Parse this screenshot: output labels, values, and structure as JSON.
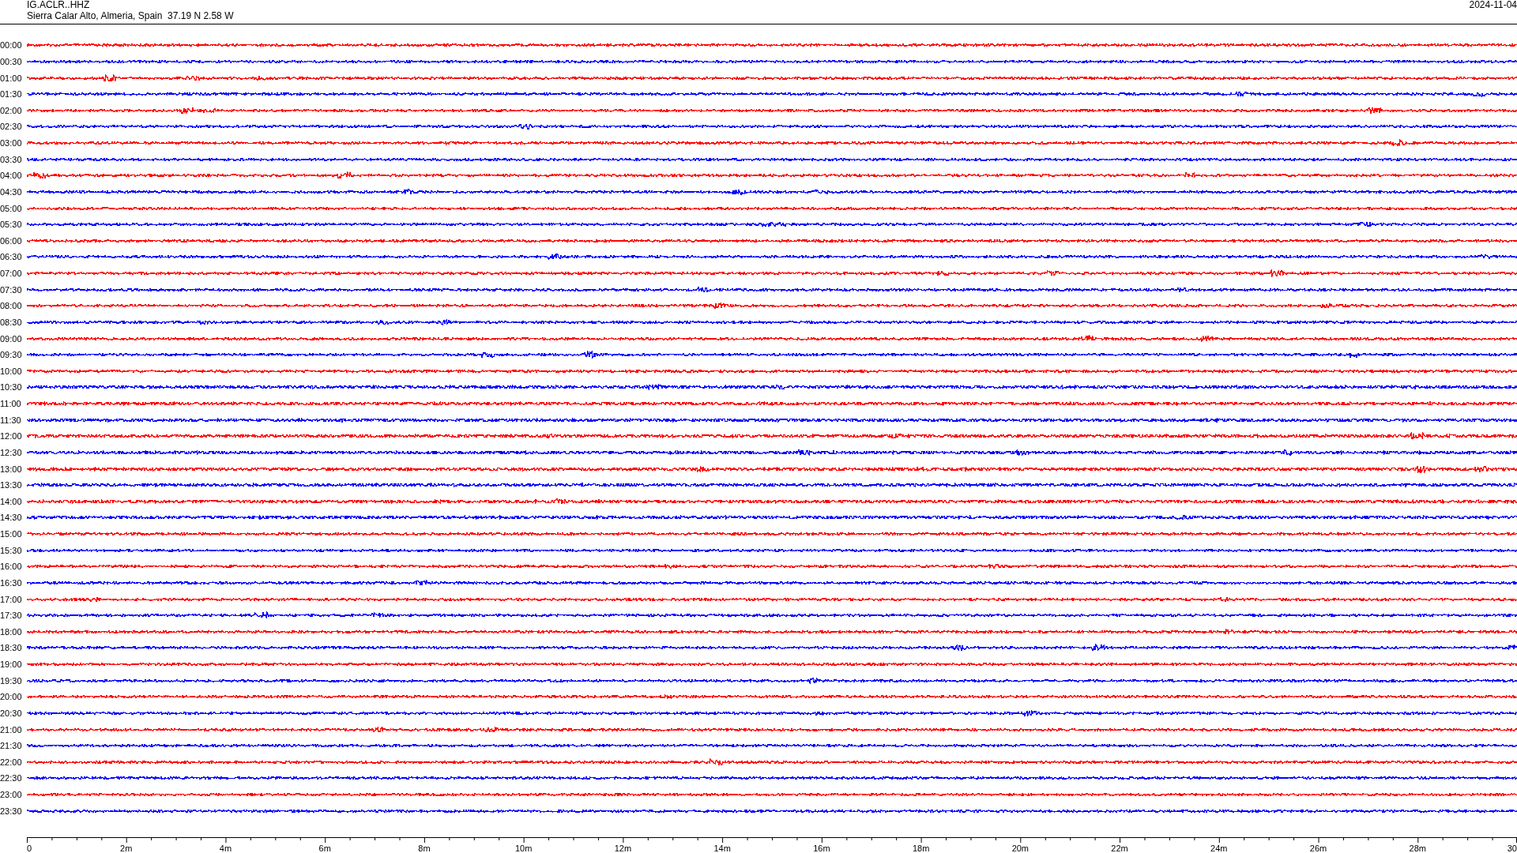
{
  "header": {
    "station": "IG.ACLR..HHZ",
    "location": "Sierra Calar Alto, Almeria, Spain  37.19 N 2.58 W",
    "date": "2024-11-04"
  },
  "traces": [
    {
      "time": "00:00",
      "color": "#ff0000"
    },
    {
      "time": "00:30",
      "color": "#0000ff"
    },
    {
      "time": "01:00",
      "color": "#ff0000"
    },
    {
      "time": "01:30",
      "color": "#0000ff"
    },
    {
      "time": "02:00",
      "color": "#ff0000"
    },
    {
      "time": "02:30",
      "color": "#0000ff"
    },
    {
      "time": "03:00",
      "color": "#ff0000"
    },
    {
      "time": "03:30",
      "color": "#0000ff"
    },
    {
      "time": "04:00",
      "color": "#ff0000"
    },
    {
      "time": "04:30",
      "color": "#0000ff"
    },
    {
      "time": "05:00",
      "color": "#ff0000"
    },
    {
      "time": "05:30",
      "color": "#0000ff"
    },
    {
      "time": "06:00",
      "color": "#ff0000"
    },
    {
      "time": "06:30",
      "color": "#0000ff"
    },
    {
      "time": "07:00",
      "color": "#ff0000"
    },
    {
      "time": "07:30",
      "color": "#0000ff"
    },
    {
      "time": "08:00",
      "color": "#ff0000"
    },
    {
      "time": "08:30",
      "color": "#0000ff"
    },
    {
      "time": "09:00",
      "color": "#ff0000"
    },
    {
      "time": "09:30",
      "color": "#0000ff"
    },
    {
      "time": "10:00",
      "color": "#ff0000"
    },
    {
      "time": "10:30",
      "color": "#0000ff"
    },
    {
      "time": "11:00",
      "color": "#ff0000"
    },
    {
      "time": "11:30",
      "color": "#0000ff"
    },
    {
      "time": "12:00",
      "color": "#ff0000"
    },
    {
      "time": "12:30",
      "color": "#0000ff"
    },
    {
      "time": "13:00",
      "color": "#ff0000"
    },
    {
      "time": "13:30",
      "color": "#0000ff"
    },
    {
      "time": "14:00",
      "color": "#ff0000"
    },
    {
      "time": "14:30",
      "color": "#0000ff"
    },
    {
      "time": "15:00",
      "color": "#ff0000"
    },
    {
      "time": "15:30",
      "color": "#0000ff"
    },
    {
      "time": "16:00",
      "color": "#ff0000"
    },
    {
      "time": "16:30",
      "color": "#0000ff"
    },
    {
      "time": "17:00",
      "color": "#ff0000"
    },
    {
      "time": "17:30",
      "color": "#0000ff"
    },
    {
      "time": "18:00",
      "color": "#ff0000"
    },
    {
      "time": "18:30",
      "color": "#0000ff"
    },
    {
      "time": "19:00",
      "color": "#ff0000"
    },
    {
      "time": "19:30",
      "color": "#0000ff"
    },
    {
      "time": "20:00",
      "color": "#ff0000"
    },
    {
      "time": "20:30",
      "color": "#0000ff"
    },
    {
      "time": "21:00",
      "color": "#ff0000"
    },
    {
      "time": "21:30",
      "color": "#0000ff"
    },
    {
      "time": "22:00",
      "color": "#ff0000"
    },
    {
      "time": "22:30",
      "color": "#0000ff"
    },
    {
      "time": "23:00",
      "color": "#ff0000"
    },
    {
      "time": "23:30",
      "color": "#0000ff"
    }
  ],
  "x_axis": {
    "ticks": [
      "0",
      "2m",
      "4m",
      "6m",
      "8m",
      "10m",
      "12m",
      "14m",
      "16m",
      "18m",
      "20m",
      "22m",
      "24m",
      "26m",
      "28m",
      "30"
    ]
  }
}
